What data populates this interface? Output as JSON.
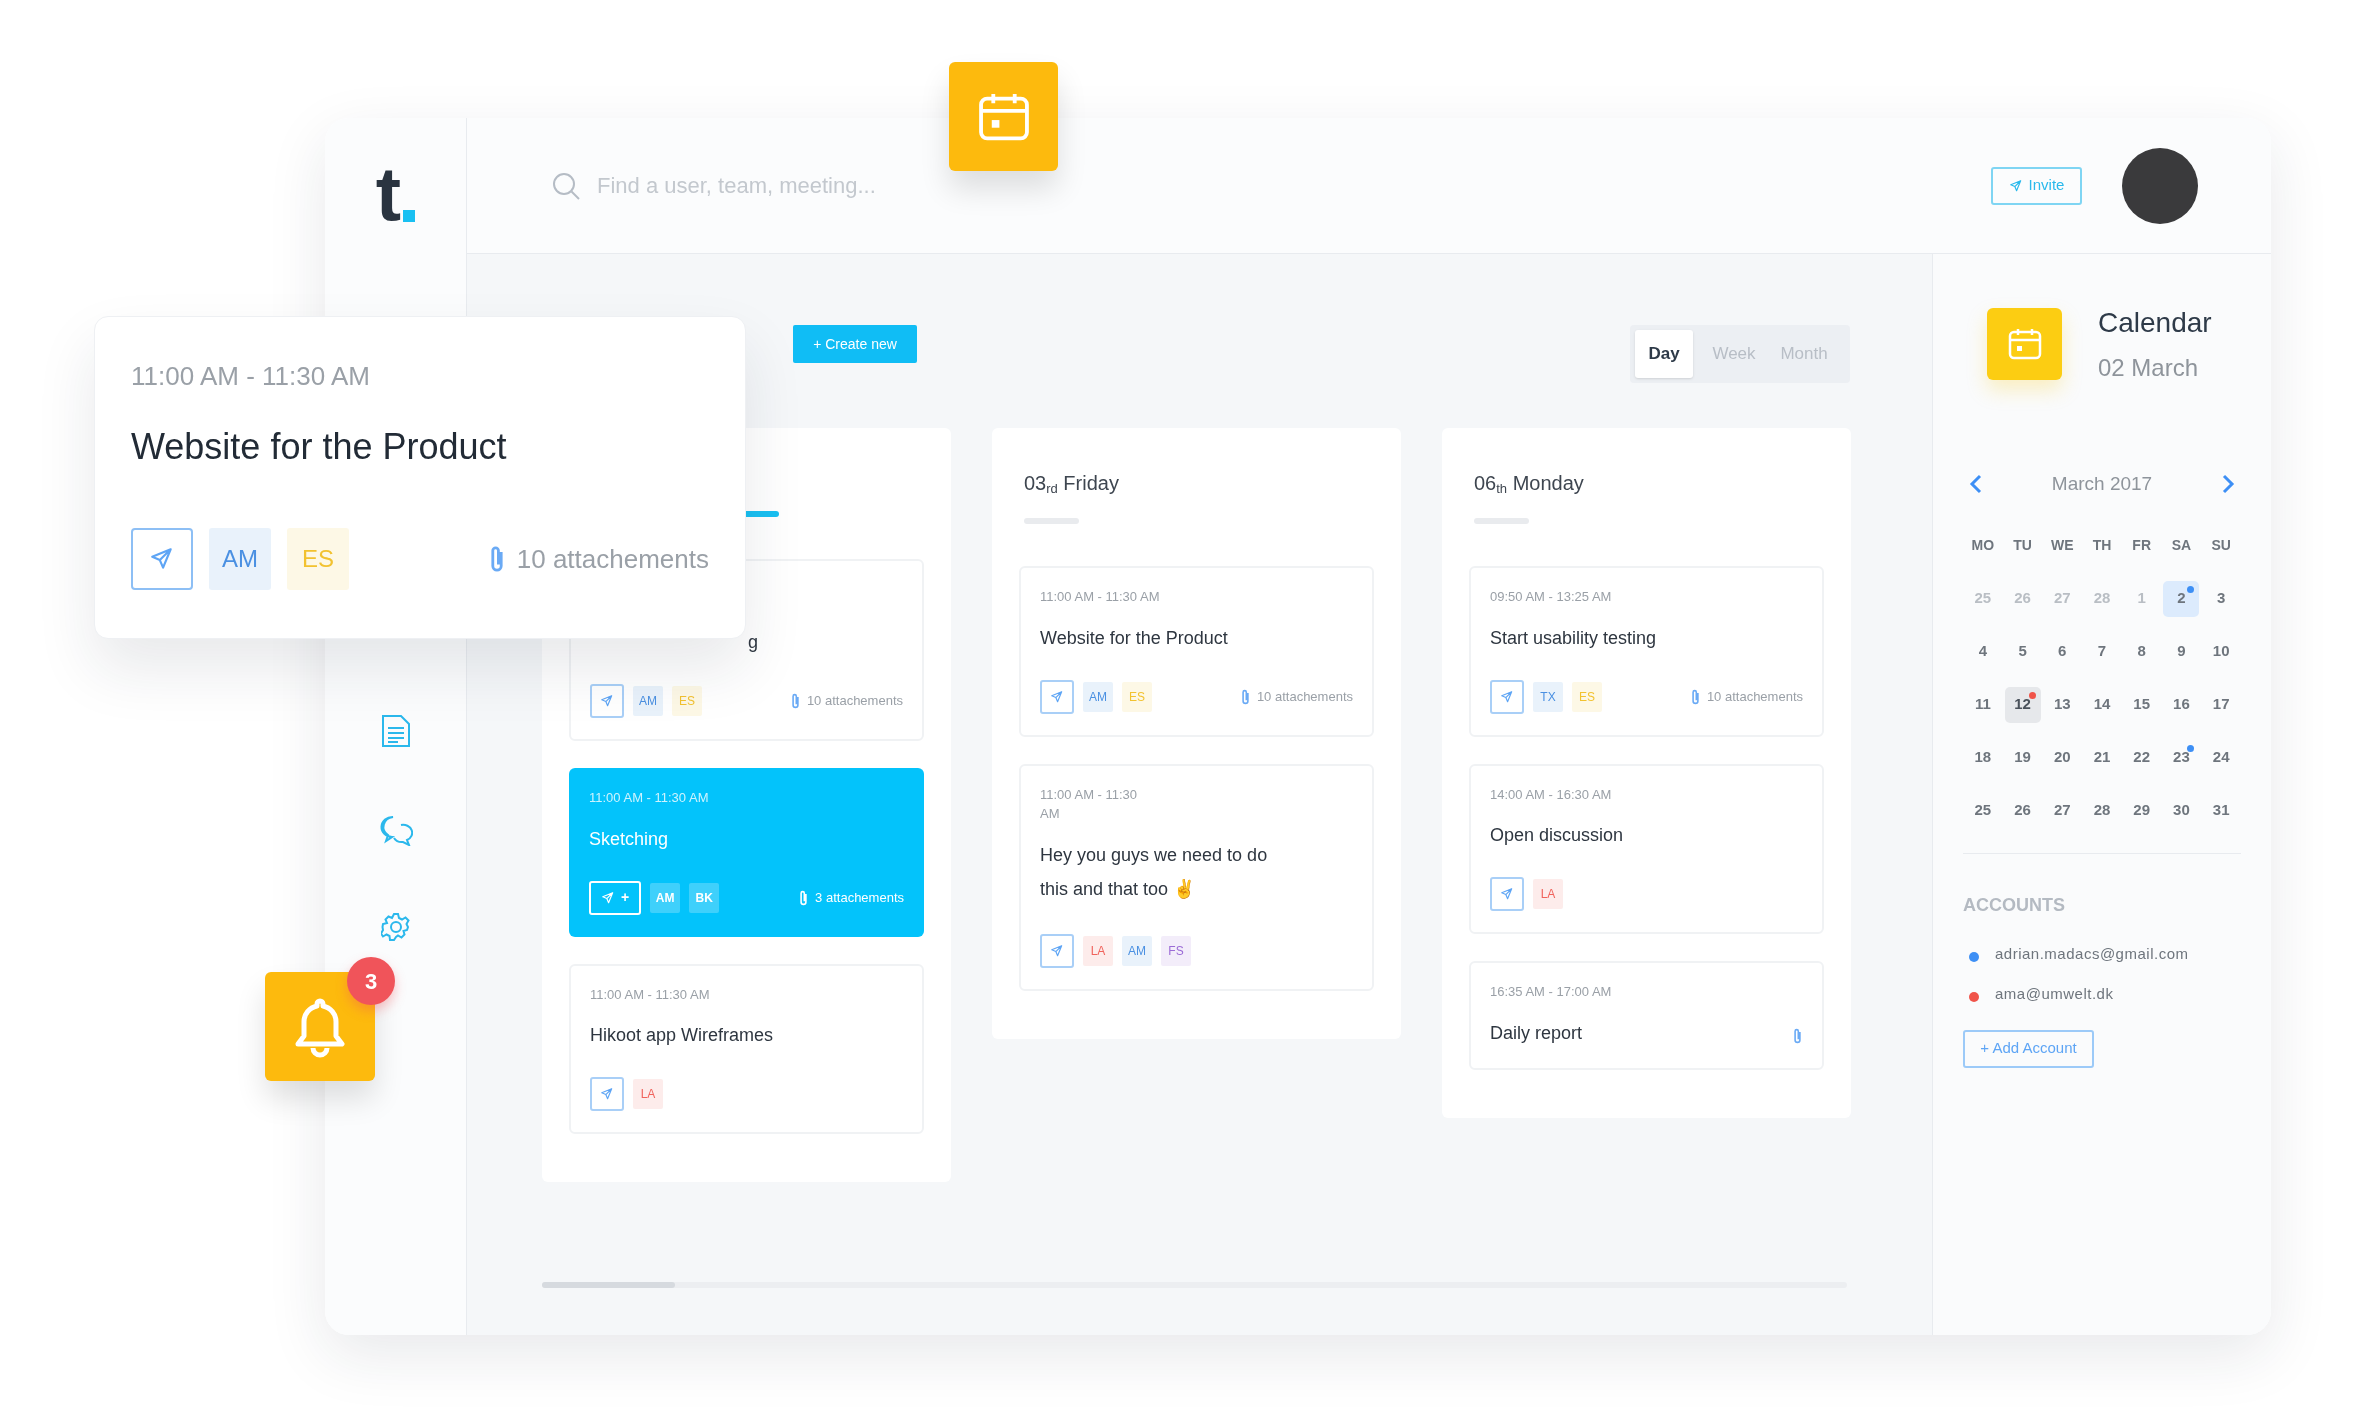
{
  "sidebar": {
    "logo": "t"
  },
  "header": {
    "search": {
      "placeholder": "Find a user, team, meeting..."
    },
    "invite": "Invite"
  },
  "toolbar": {
    "create": "+ Create new",
    "views": [
      {
        "label": "Day",
        "selected": true
      },
      {
        "label": "Week",
        "selected": false
      },
      {
        "label": "Month",
        "selected": false
      }
    ]
  },
  "columns": [
    {
      "selected": true,
      "cards": [
        {
          "kind": "covered",
          "title": "g",
          "active": false,
          "send": true,
          "tags": [
            {
              "text": "AM",
              "color": "#4a90e2"
            },
            {
              "text": "ES",
              "color": "#f2c230"
            }
          ],
          "attachment": true,
          "attachments": "10 attachements"
        },
        {
          "kind": "event",
          "time": "11:00 AM - 11:30 AM",
          "title": "Sketching",
          "active": true,
          "send": true,
          "send_label": "+",
          "tags": [
            {
              "text": "AM"
            },
            {
              "text": "BK"
            }
          ],
          "attachment": true,
          "attachments": "3 attachements"
        },
        {
          "kind": "event",
          "time": "11:00 AM - 11:30 AM",
          "title": "Hikoot app Wireframes",
          "active": false,
          "send": true,
          "tags": [
            {
              "text": "LA",
              "color": "#f0635c"
            }
          ],
          "attachment": false
        }
      ]
    },
    {
      "title": "03$_{rd}$ Friday",
      "selected": false,
      "cards": [
        {
          "kind": "event",
          "time": "11:00 AM - 11:30 AM",
          "title": "Website for the Product",
          "active": false,
          "send": true,
          "tags": [
            {
              "text": "AM",
              "color": "#4a90e2"
            },
            {
              "text": "ES",
              "color": "#f2c230"
            }
          ],
          "attachment": true,
          "attachments": "10 attachements"
        },
        {
          "kind": "message",
          "time": "11:00 AM - 11:30 AM",
          "title": "Hey you guys we need to do this and that too ✌",
          "active": false,
          "send": true,
          "tags": [
            {
              "text": "LA",
              "color": "#f0635c"
            },
            {
              "text": "AM",
              "color": "#4a90e2"
            },
            {
              "text": "FS",
              "color": "#9b6bd6"
            }
          ],
          "attachment": false
        }
      ]
    },
    {
      "title": "06$_{th}$ Monday",
      "selected": false,
      "cards": [
        {
          "kind": "event",
          "time": "09:50 AM - 13:25 AM",
          "title": "Start usability testing",
          "active": false,
          "send": true,
          "tags": [
            {
              "text": "TX",
              "color": "#4a90e2"
            },
            {
              "text": "ES",
              "color": "#f2c230"
            }
          ],
          "attachment": true,
          "attachments": "10 attachements"
        },
        {
          "kind": "event",
          "time": "14:00 AM - 16:30 AM",
          "title": "Open discussion",
          "active": false,
          "send": true,
          "tags": [
            {
              "text": "LA",
              "color": "#f0635c"
            }
          ],
          "attachment": false
        },
        {
          "kind": "event",
          "time": "16:35 AM - 17:00 AM",
          "title": "Daily report",
          "active": false,
          "send": false,
          "attachment": true
        }
      ]
    }
  ],
  "popup": {
    "time": "11:00 AM - 11:30 AM",
    "title": "Website for the Product",
    "tags": [
      {
        "text": "AM",
        "color": "#4a90e2"
      },
      {
        "text": "ES",
        "color": "#f2c230"
      }
    ],
    "attachments": "10 attachements"
  },
  "notifications": {
    "count": "3"
  },
  "calendar": {
    "title": "Calendar",
    "date": "02 March",
    "month": "March 2017",
    "weekdays": [
      "MO",
      "TU",
      "WE",
      "TH",
      "FR",
      "SA",
      "SU"
    ],
    "weeks": [
      [
        {
          "label": "25",
          "muted": true,
          "selected": false,
          "today": false
        },
        {
          "label": "26",
          "muted": true,
          "selected": false,
          "today": false
        },
        {
          "label": "27",
          "muted": true,
          "selected": false,
          "today": false
        },
        {
          "label": "28",
          "muted": true,
          "selected": false,
          "today": false
        },
        {
          "label": "1",
          "muted": true,
          "selected": false,
          "today": false
        },
        {
          "label": "2",
          "muted": false,
          "selected": true,
          "today": false,
          "color": "#3d8ff5"
        },
        {
          "label": "3",
          "muted": false,
          "selected": false,
          "today": false
        }
      ],
      [
        {
          "label": "4",
          "muted": false,
          "selected": false,
          "today": false
        },
        {
          "label": "5",
          "muted": false,
          "selected": false,
          "today": false
        },
        {
          "label": "6",
          "muted": false,
          "selected": false,
          "today": false
        },
        {
          "label": "7",
          "muted": false,
          "selected": false,
          "today": false
        },
        {
          "label": "8",
          "muted": false,
          "selected": false,
          "today": false
        },
        {
          "label": "9",
          "muted": false,
          "selected": false,
          "today": false
        },
        {
          "label": "10",
          "muted": false,
          "selected": false,
          "today": false
        }
      ],
      [
        {
          "label": "11",
          "muted": false,
          "selected": false,
          "today": false
        },
        {
          "label": "12",
          "muted": false,
          "selected": false,
          "today": true,
          "color": "#f0544a"
        },
        {
          "label": "13",
          "muted": false,
          "selected": false,
          "today": false
        },
        {
          "label": "14",
          "muted": false,
          "selected": false,
          "today": false
        },
        {
          "label": "15",
          "muted": false,
          "selected": false,
          "today": false
        },
        {
          "label": "16",
          "muted": false,
          "selected": false,
          "today": false
        },
        {
          "label": "17",
          "muted": false,
          "selected": false,
          "today": false
        }
      ],
      [
        {
          "label": "18",
          "muted": false,
          "selected": false,
          "today": false
        },
        {
          "label": "19",
          "muted": false,
          "selected": false,
          "today": false
        },
        {
          "label": "20",
          "muted": false,
          "selected": false,
          "today": false
        },
        {
          "label": "21",
          "muted": false,
          "selected": false,
          "today": false
        },
        {
          "label": "22",
          "muted": false,
          "selected": false,
          "today": false
        },
        {
          "label": "23",
          "muted": false,
          "selected": false,
          "today": false,
          "color": "#3d8ff5"
        },
        {
          "label": "24",
          "muted": false,
          "selected": false,
          "today": false
        }
      ],
      [
        {
          "label": "25",
          "muted": false,
          "selected": false,
          "today": false
        },
        {
          "label": "26",
          "muted": false,
          "selected": false,
          "today": false
        },
        {
          "label": "27",
          "muted": false,
          "selected": false,
          "today": false
        },
        {
          "label": "28",
          "muted": false,
          "selected": false,
          "today": false
        },
        {
          "label": "29",
          "muted": false,
          "selected": false,
          "today": false
        },
        {
          "label": "30",
          "muted": false,
          "selected": false,
          "today": false
        },
        {
          "label": "31",
          "muted": false,
          "selected": false,
          "today": false
        }
      ]
    ]
  },
  "accounts": {
    "heading": "ACCOUNTS",
    "items": [
      {
        "email": "adrian.madacs@gmail.com",
        "color": "#3d8ff5"
      },
      {
        "email": "ama@umwelt.dk",
        "color": "#f0544a"
      }
    ],
    "add": "+ Add Account"
  }
}
